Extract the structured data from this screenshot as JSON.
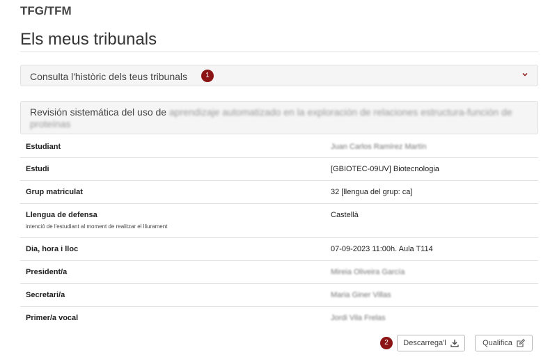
{
  "header": {
    "app_title": "TFG/TFM",
    "page_title": "Els meus tribunals"
  },
  "history": {
    "label": "Consulta l'històric dels teus tribunals",
    "badge": "1"
  },
  "thesis": {
    "title_visible": "Revisión sistemática del uso de ",
    "title_blurred": "aprendizaje automatizado en la exploración de relaciones estructura-función de proteínas"
  },
  "details": [
    {
      "label": "Estudiant",
      "value": "Juan Carlos Ramírez Martín",
      "blurred": true
    },
    {
      "label": "Estudi",
      "value": "[GBIOTEC-09UV] Biotecnologia",
      "blurred": false
    },
    {
      "label": "Grup matriculat",
      "value": "32 [llengua del grup: ca]",
      "blurred": false
    },
    {
      "label": "Llengua de defensa",
      "sublabel": "intenció de l'estudiant al moment de realitzar el lliurament",
      "value": "Castellà",
      "blurred": false
    },
    {
      "label": "Dia, hora i lloc",
      "value": "07-09-2023 11:00h. Aula T114",
      "blurred": false
    },
    {
      "label": "President/a",
      "value": "Mireia Oliveira García",
      "blurred": true
    },
    {
      "label": "Secretari/a",
      "value": "Maria Giner Villas",
      "blurred": true
    },
    {
      "label": "Primer/a vocal",
      "value": "Jordi Vila Frelas",
      "blurred": true
    }
  ],
  "actions": {
    "badge": "2",
    "download_label": "Descarrega'l",
    "grade_label": "Qualifica"
  },
  "colors": {
    "badge": "#8b1414",
    "panel_bg": "#f5f5f5"
  },
  "icons": {
    "history_toggle": "chevron-down-icon",
    "download": "download-icon",
    "grade": "edit-icon"
  }
}
